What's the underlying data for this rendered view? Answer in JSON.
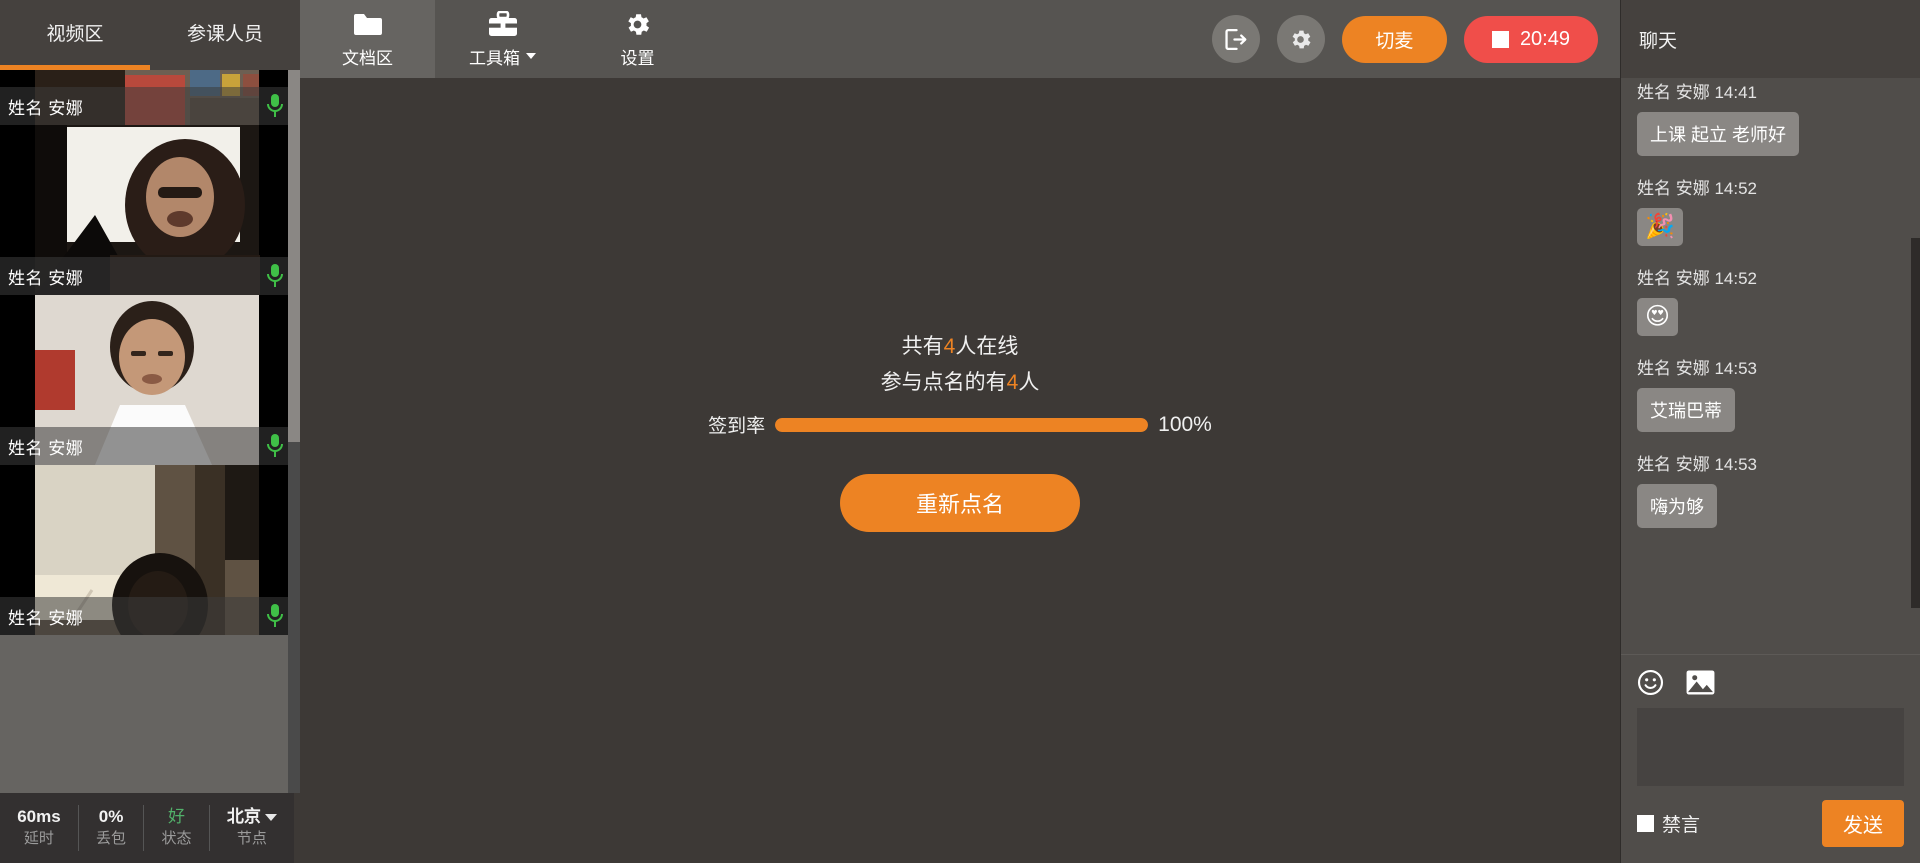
{
  "left_panel": {
    "tabs": [
      {
        "label": "视频区",
        "active": true
      },
      {
        "label": "参课人员",
        "active": false
      }
    ],
    "videos": [
      {
        "name": "姓名 安娜",
        "mic": "mic-on"
      },
      {
        "name": "姓名 安娜",
        "mic": "mic-on"
      },
      {
        "name": "姓名 安娜",
        "mic": "mic-on"
      },
      {
        "name": "姓名 安娜",
        "mic": "mic-on"
      }
    ],
    "status": {
      "latency_value": "60ms",
      "latency_label": "延时",
      "loss_value": "0%",
      "loss_label": "丢包",
      "state_value": "好",
      "state_label": "状态",
      "node_value": "北京",
      "node_label": "节点"
    }
  },
  "toolbar": {
    "items": [
      {
        "label": "文档区",
        "icon": "folder-icon",
        "active": true,
        "has_caret": false
      },
      {
        "label": "工具箱",
        "icon": "toolbox-icon",
        "active": false,
        "has_caret": true
      },
      {
        "label": "设置",
        "icon": "gear-icon",
        "active": false,
        "has_caret": false
      }
    ],
    "exit_icon": "exit-icon",
    "settings_icon": "gear-icon",
    "mic_switch_label": "切麦",
    "record_time": "20:49",
    "record_icon": "stop-square-icon"
  },
  "stage": {
    "online_prefix": "共有",
    "online_count": "4",
    "online_suffix": "人在线",
    "participate_prefix": "参与点名的有",
    "participate_count": "4",
    "participate_suffix": "人",
    "rate_label": "签到率",
    "rate_percent": "100%",
    "rate_value": 100,
    "action_button": "重新点名"
  },
  "chat": {
    "title": "聊天",
    "messages": [
      {
        "meta": "姓名 安娜 14:41",
        "text": "上课 起立 老师好",
        "type": "text"
      },
      {
        "meta": "姓名 安娜 14:52",
        "text": "🎉",
        "type": "emoji"
      },
      {
        "meta": "姓名 安娜 14:52",
        "text": "😍",
        "type": "emoji"
      },
      {
        "meta": "姓名 安娜 14:53",
        "text": "艾瑞巴蒂",
        "type": "text"
      },
      {
        "meta": "姓名 安娜 14:53",
        "text": "嗨为够",
        "type": "text"
      }
    ],
    "emoji_icon": "smiley-icon",
    "image_icon": "image-icon",
    "input_value": "",
    "input_placeholder": "",
    "mute_label": "禁言",
    "mute_checked": false,
    "send_label": "发送"
  },
  "colors": {
    "accent_orange": "#ed8323",
    "record_red": "#f04e4a",
    "status_good_green": "#52b06a",
    "mic_green": "#3fbf47",
    "header_bg": "#565451",
    "panel_bg": "#3d3936"
  }
}
